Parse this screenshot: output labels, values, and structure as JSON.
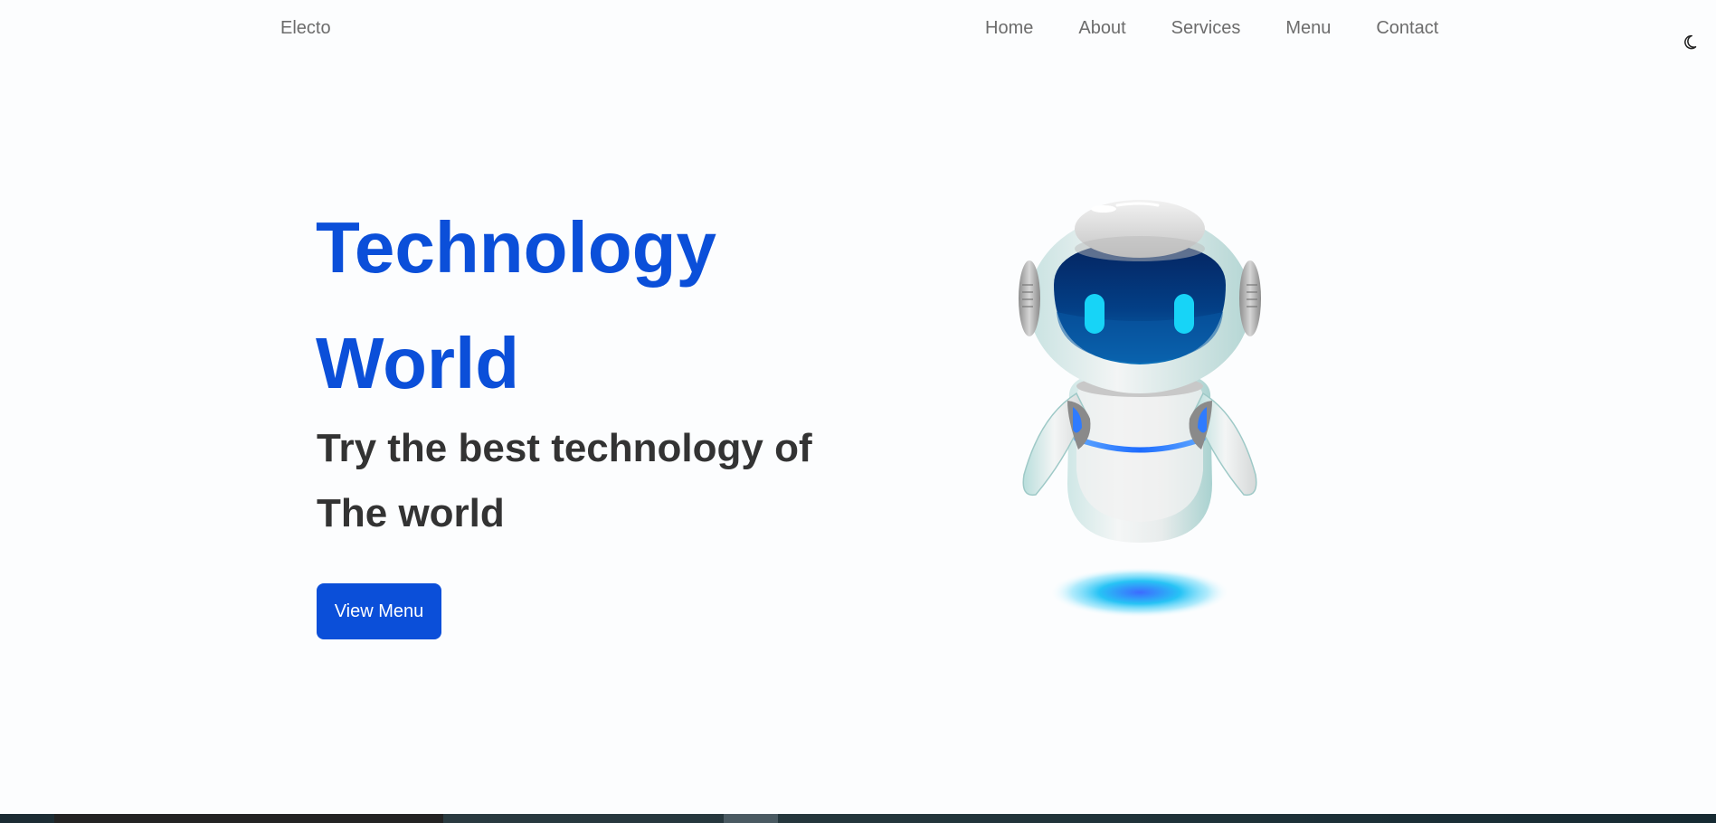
{
  "navbar": {
    "brand": "Electo",
    "links": [
      {
        "label": "Home"
      },
      {
        "label": "About"
      },
      {
        "label": "Services"
      },
      {
        "label": "Menu"
      },
      {
        "label": "Contact"
      }
    ],
    "theme_toggle_icon": "moon-icon"
  },
  "hero": {
    "title_line1": "Technology",
    "title_line2": "World",
    "subtitle_line1": "Try the best technology of",
    "subtitle_line2": "The world",
    "cta_label": "View Menu",
    "illustration_icon": "robot-illustration"
  },
  "colors": {
    "accent": "#0b4fd9",
    "heading_dark": "#333333",
    "nav_text": "#6c6c6c",
    "background": "#fcfdfe"
  }
}
